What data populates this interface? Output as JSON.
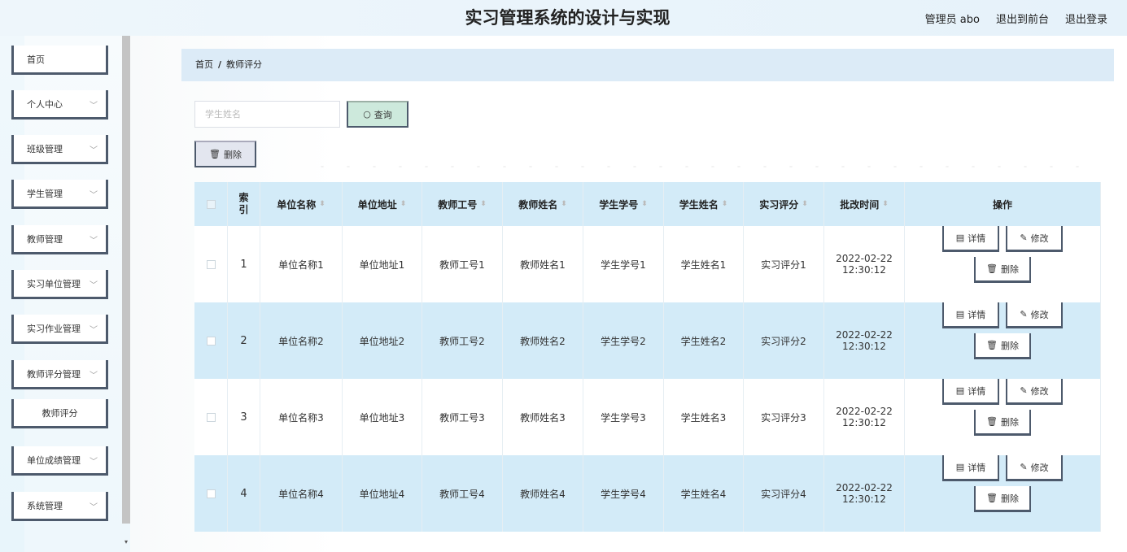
{
  "header": {
    "title": "实习管理系统的设计与实现",
    "admin": "管理员 abo",
    "to_front": "退出到前台",
    "logout": "退出登录"
  },
  "sidebar": {
    "items": [
      {
        "label": "首页",
        "has_chevron": false
      },
      {
        "label": "个人中心",
        "has_chevron": true
      },
      {
        "label": "班级管理",
        "has_chevron": true
      },
      {
        "label": "学生管理",
        "has_chevron": true
      },
      {
        "label": "教师管理",
        "has_chevron": true
      },
      {
        "label": "实习单位管理",
        "has_chevron": true
      },
      {
        "label": "实习作业管理",
        "has_chevron": true
      },
      {
        "label": "教师评分管理",
        "has_chevron": true
      },
      {
        "label": "教师评分",
        "has_chevron": false,
        "sub": true
      },
      {
        "label": "单位成绩管理",
        "has_chevron": true
      },
      {
        "label": "系统管理",
        "has_chevron": true
      }
    ]
  },
  "breadcrumb": {
    "home": "首页",
    "separator": "/",
    "current": "教师评分"
  },
  "search": {
    "placeholder": "学生姓名",
    "query_label": "查询",
    "delete_label": "删除"
  },
  "table": {
    "headers": [
      "索引",
      "单位名称",
      "单位地址",
      "教师工号",
      "教师姓名",
      "学生学号",
      "学生姓名",
      "实习评分",
      "批改时间",
      "操作"
    ],
    "rows": [
      {
        "index": "1",
        "unit_name": "单位名称1",
        "unit_addr": "单位地址1",
        "teacher_no": "教师工号1",
        "teacher_name": "教师姓名1",
        "student_no": "学生学号1",
        "student_name": "学生姓名1",
        "score": "实习评分1",
        "time_date": "2022-02-22",
        "time_clock": "12:30:12"
      },
      {
        "index": "2",
        "unit_name": "单位名称2",
        "unit_addr": "单位地址2",
        "teacher_no": "教师工号2",
        "teacher_name": "教师姓名2",
        "student_no": "学生学号2",
        "student_name": "学生姓名2",
        "score": "实习评分2",
        "time_date": "2022-02-22",
        "time_clock": "12:30:12"
      },
      {
        "index": "3",
        "unit_name": "单位名称3",
        "unit_addr": "单位地址3",
        "teacher_no": "教师工号3",
        "teacher_name": "教师姓名3",
        "student_no": "学生学号3",
        "student_name": "学生姓名3",
        "score": "实习评分3",
        "time_date": "2022-02-22",
        "time_clock": "12:30:12"
      },
      {
        "index": "4",
        "unit_name": "单位名称4",
        "unit_addr": "单位地址4",
        "teacher_no": "教师工号4",
        "teacher_name": "教师姓名4",
        "student_no": "学生学号4",
        "student_name": "学生姓名4",
        "score": "实习评分4",
        "time_date": "2022-02-22",
        "time_clock": "12:30:12"
      }
    ],
    "actions": {
      "detail": "详情",
      "edit": "修改",
      "delete": "删除"
    }
  },
  "icons": {
    "search": "search-icon",
    "trash": "trash-icon",
    "detail": "document-icon",
    "edit": "pencil-icon",
    "chevron": "chevron-down-icon"
  }
}
